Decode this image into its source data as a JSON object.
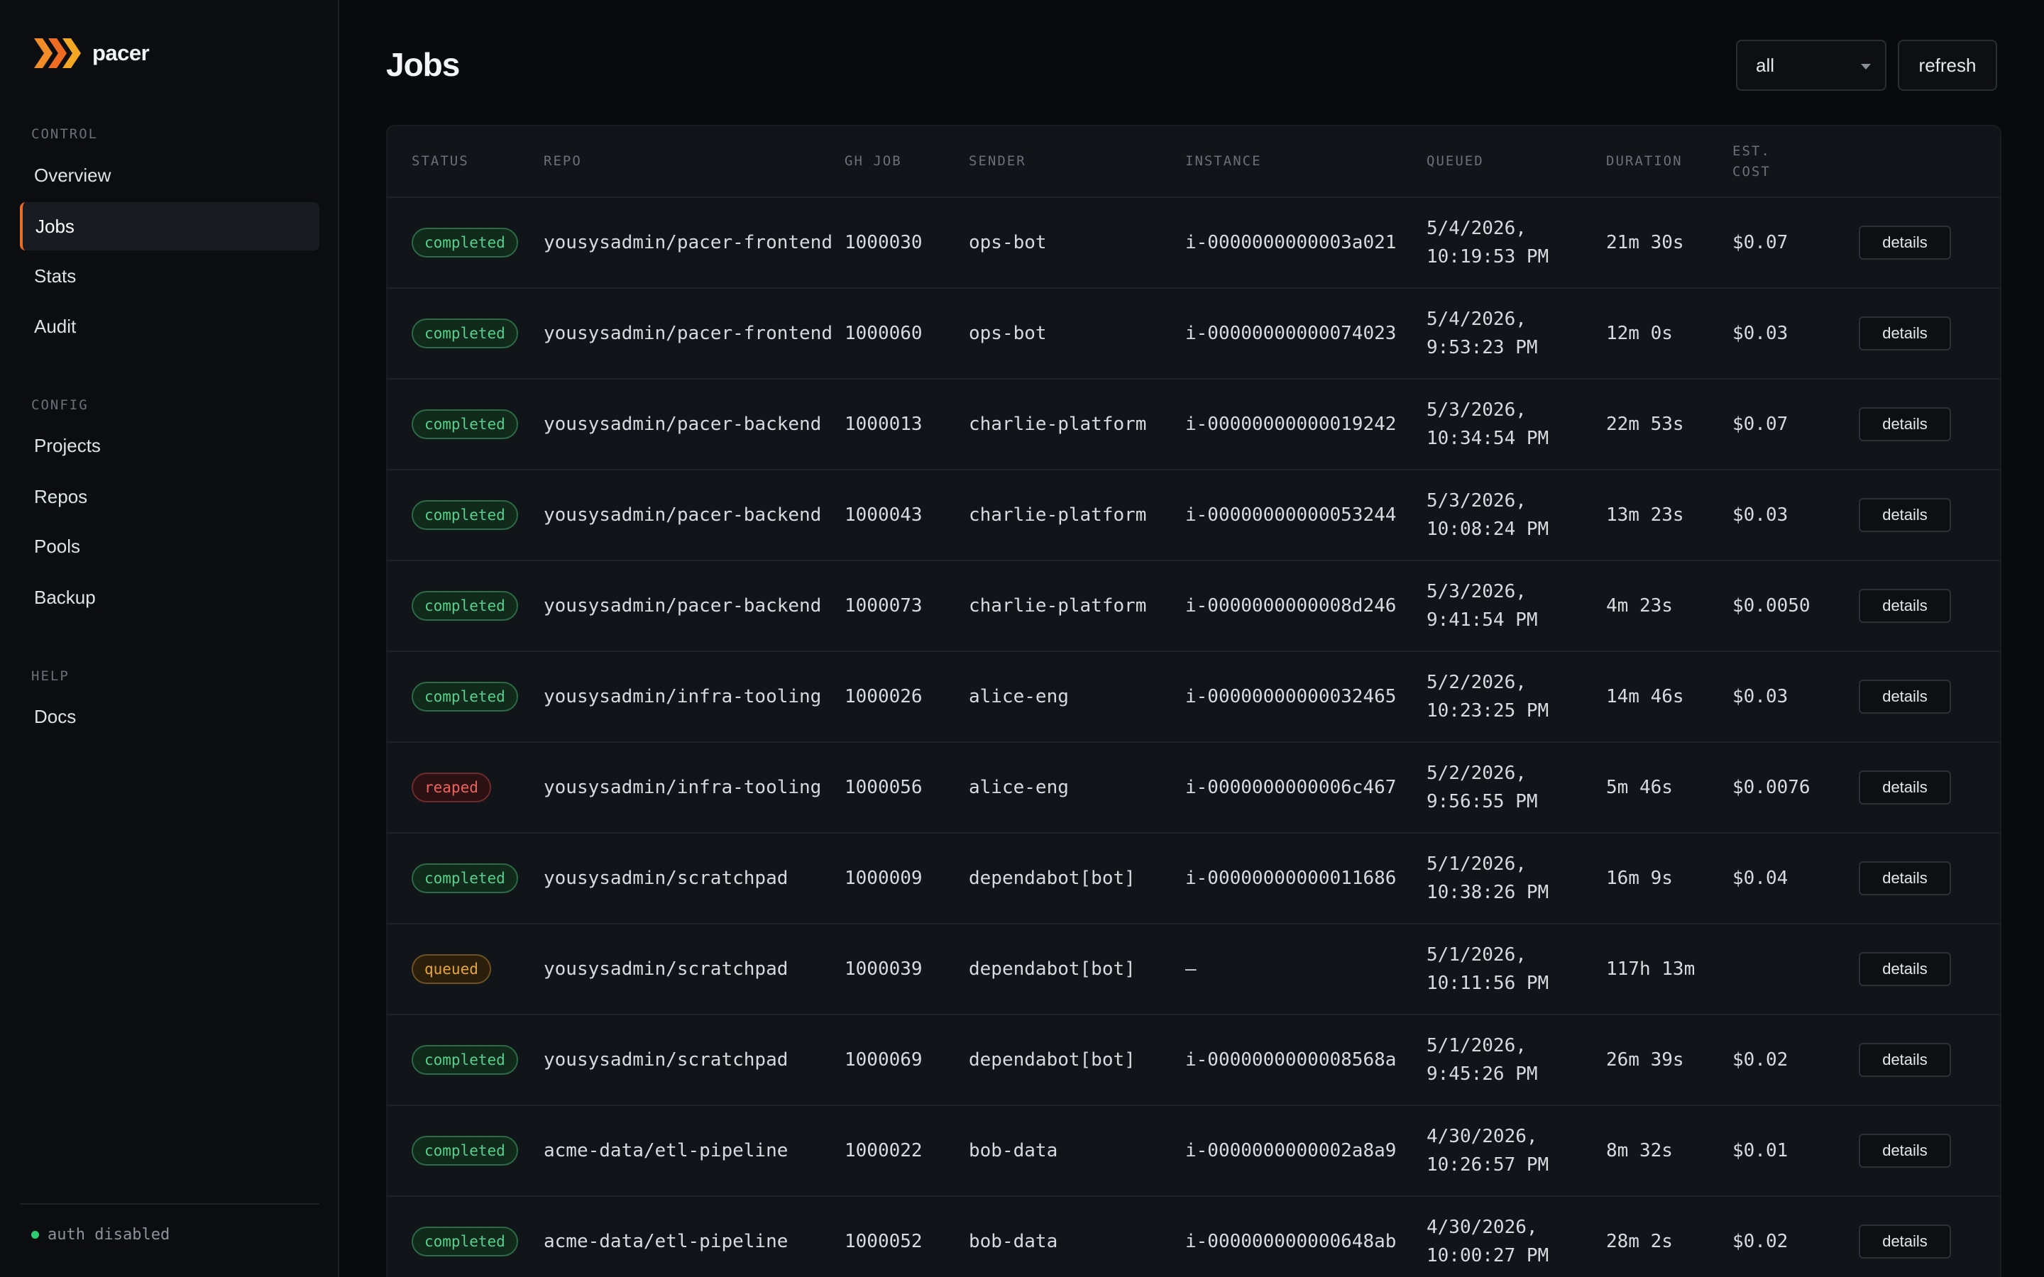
{
  "brand": {
    "name": "pacer",
    "accent": "#ee6b22"
  },
  "sidebar": {
    "sections": [
      {
        "label": "CONTROL",
        "items": [
          "Overview",
          "Jobs",
          "Stats",
          "Audit"
        ]
      },
      {
        "label": "CONFIG",
        "items": [
          "Projects",
          "Repos",
          "Pools",
          "Backup"
        ]
      },
      {
        "label": "HELP",
        "items": [
          "Docs"
        ]
      }
    ],
    "active_item": "Jobs",
    "auth_status": "auth disabled"
  },
  "header": {
    "title": "Jobs",
    "filter_value": "all",
    "refresh_label": "refresh"
  },
  "table": {
    "columns": [
      "STATUS",
      "REPO",
      "GH JOB",
      "SENDER",
      "INSTANCE",
      "QUEUED",
      "DURATION",
      "EST. COST",
      ""
    ],
    "rows": [
      {
        "status": "completed",
        "repo": "yousysadmin/pacer-frontend",
        "gh_job": "1000030",
        "sender": "ops-bot",
        "instance": "i-0000000000003a021",
        "queued": "5/4/2026, 10:19:53 PM",
        "duration": "21m 30s",
        "cost": "$0.07",
        "action": "details"
      },
      {
        "status": "completed",
        "repo": "yousysadmin/pacer-frontend",
        "gh_job": "1000060",
        "sender": "ops-bot",
        "instance": "i-00000000000074023",
        "queued": "5/4/2026, 9:53:23 PM",
        "duration": "12m 0s",
        "cost": "$0.03",
        "action": "details"
      },
      {
        "status": "completed",
        "repo": "yousysadmin/pacer-backend",
        "gh_job": "1000013",
        "sender": "charlie-platform",
        "instance": "i-00000000000019242",
        "queued": "5/3/2026, 10:34:54 PM",
        "duration": "22m 53s",
        "cost": "$0.07",
        "action": "details"
      },
      {
        "status": "completed",
        "repo": "yousysadmin/pacer-backend",
        "gh_job": "1000043",
        "sender": "charlie-platform",
        "instance": "i-00000000000053244",
        "queued": "5/3/2026, 10:08:24 PM",
        "duration": "13m 23s",
        "cost": "$0.03",
        "action": "details"
      },
      {
        "status": "completed",
        "repo": "yousysadmin/pacer-backend",
        "gh_job": "1000073",
        "sender": "charlie-platform",
        "instance": "i-0000000000008d246",
        "queued": "5/3/2026, 9:41:54 PM",
        "duration": "4m 23s",
        "cost": "$0.0050",
        "action": "details"
      },
      {
        "status": "completed",
        "repo": "yousysadmin/infra-tooling",
        "gh_job": "1000026",
        "sender": "alice-eng",
        "instance": "i-00000000000032465",
        "queued": "5/2/2026, 10:23:25 PM",
        "duration": "14m 46s",
        "cost": "$0.03",
        "action": "details"
      },
      {
        "status": "reaped",
        "repo": "yousysadmin/infra-tooling",
        "gh_job": "1000056",
        "sender": "alice-eng",
        "instance": "i-0000000000006c467",
        "queued": "5/2/2026, 9:56:55 PM",
        "duration": "5m 46s",
        "cost": "$0.0076",
        "action": "details"
      },
      {
        "status": "completed",
        "repo": "yousysadmin/scratchpad",
        "gh_job": "1000009",
        "sender": "dependabot[bot]",
        "instance": "i-00000000000011686",
        "queued": "5/1/2026, 10:38:26 PM",
        "duration": "16m 9s",
        "cost": "$0.04",
        "action": "details"
      },
      {
        "status": "queued",
        "repo": "yousysadmin/scratchpad",
        "gh_job": "1000039",
        "sender": "dependabot[bot]",
        "instance": "—",
        "queued": "5/1/2026, 10:11:56 PM",
        "duration": "117h 13m",
        "cost": "",
        "action": "details"
      },
      {
        "status": "completed",
        "repo": "yousysadmin/scratchpad",
        "gh_job": "1000069",
        "sender": "dependabot[bot]",
        "instance": "i-0000000000008568a",
        "queued": "5/1/2026, 9:45:26 PM",
        "duration": "26m 39s",
        "cost": "$0.02",
        "action": "details"
      },
      {
        "status": "completed",
        "repo": "acme-data/etl-pipeline",
        "gh_job": "1000022",
        "sender": "bob-data",
        "instance": "i-0000000000002a8a9",
        "queued": "4/30/2026, 10:26:57 PM",
        "duration": "8m 32s",
        "cost": "$0.01",
        "action": "details"
      },
      {
        "status": "completed",
        "repo": "acme-data/etl-pipeline",
        "gh_job": "1000052",
        "sender": "bob-data",
        "instance": "i-000000000000648ab",
        "queued": "4/30/2026, 10:00:27 PM",
        "duration": "28m 2s",
        "cost": "$0.02",
        "action": "details"
      }
    ]
  },
  "colors": {
    "completed": "#56d08a",
    "reaped": "#f0625a",
    "queued": "#e8a538"
  }
}
